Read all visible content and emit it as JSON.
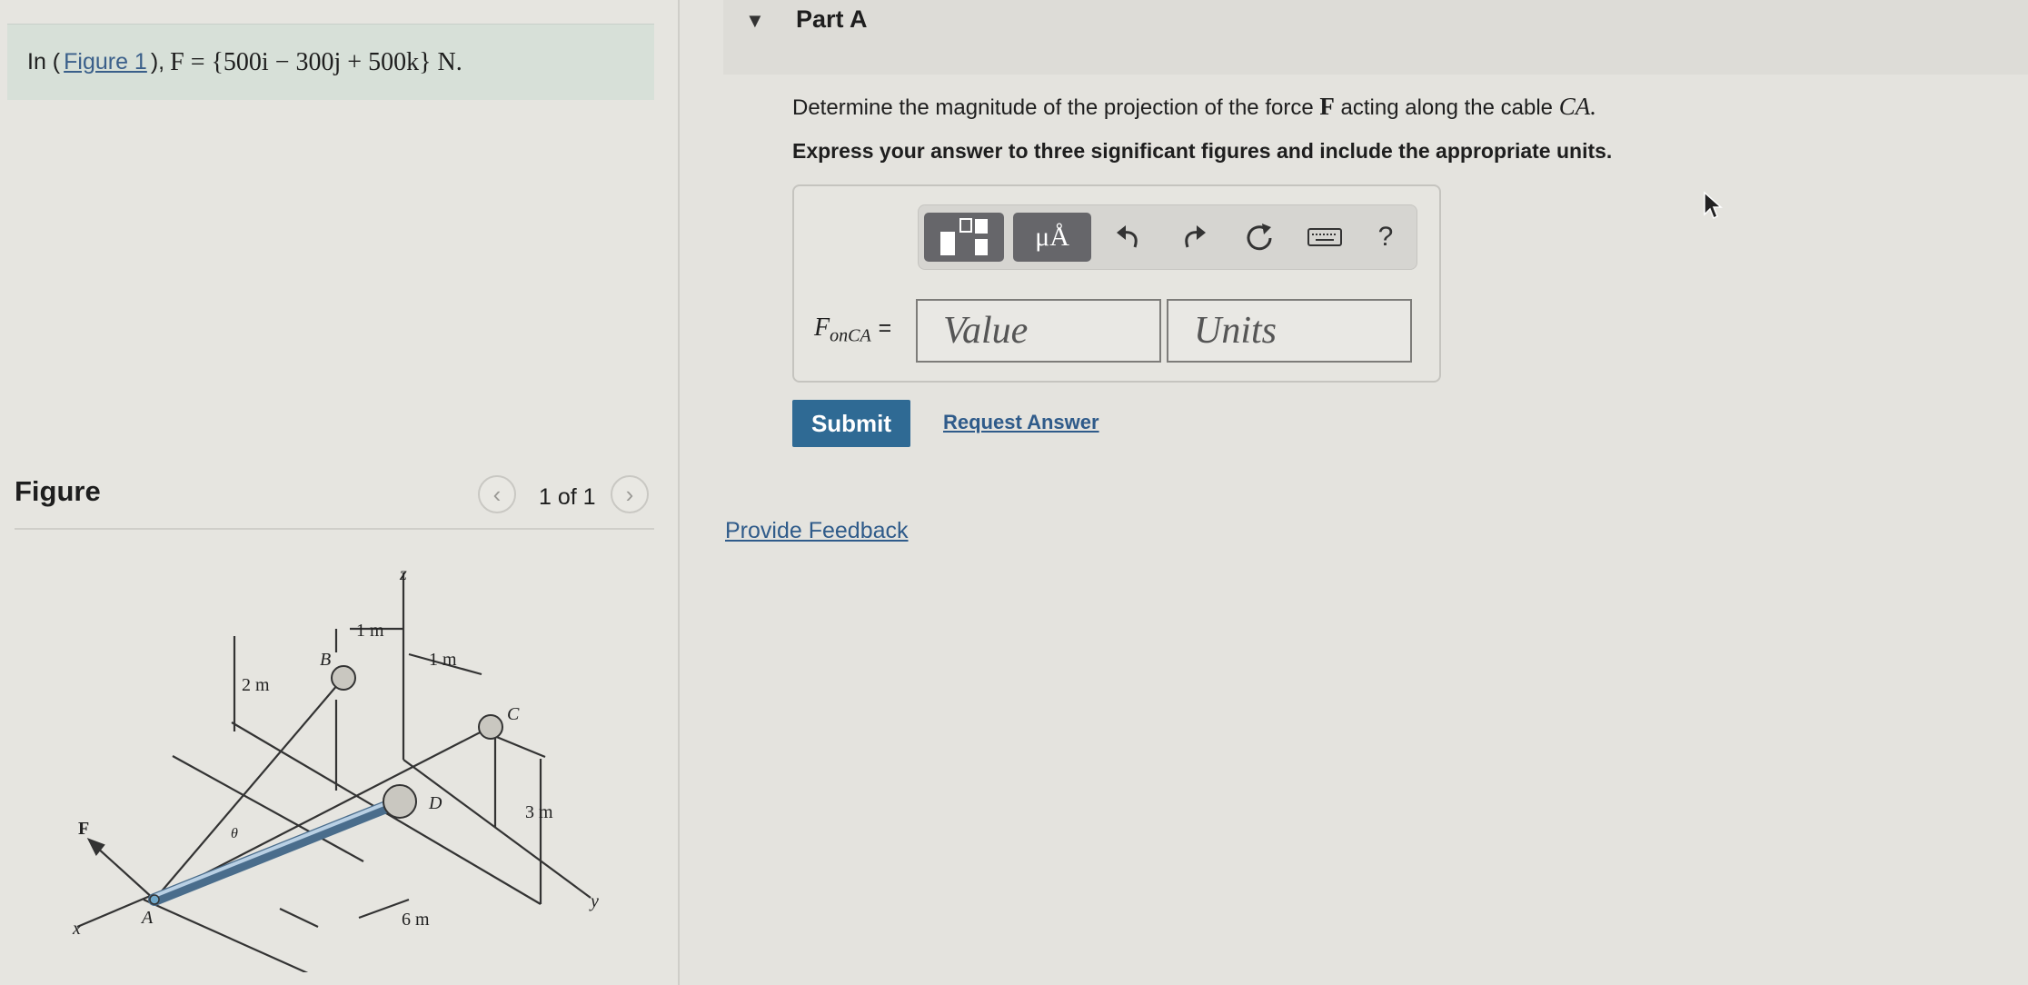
{
  "problem": {
    "prefix": "In (",
    "figure_link": "Figure 1",
    "suffix": "),",
    "equation": "F = {500i − 300j + 500k} N."
  },
  "figure_panel": {
    "title": "Figure",
    "page_indicator": "1 of 1",
    "diagram_labels": {
      "z": "z",
      "x": "x",
      "y": "y",
      "A": "A",
      "B": "B",
      "C": "C",
      "D": "D",
      "F": "F",
      "theta": "θ",
      "dim_1m_top": "1 m",
      "dim_1m_right": "1 m",
      "dim_2m": "2 m",
      "dim_3m": "3 m",
      "dim_6m": "6 m"
    }
  },
  "part": {
    "title": "Part A",
    "question_prefix": "Determine the magnitude of the projection of the force",
    "question_force": "F",
    "question_mid": "acting along the cable",
    "question_cable": "CA.",
    "instruction": "Express your answer to three significant figures and include the appropriate units."
  },
  "answer": {
    "label_var": "F",
    "label_sub": "onCA",
    "label_eq": "=",
    "value_placeholder": "Value",
    "units_placeholder": "Units",
    "units_button_label": "μÅ",
    "help_label": "?"
  },
  "actions": {
    "submit_label": "Submit",
    "request_label": "Request Answer",
    "feedback_label": "Provide Feedback"
  },
  "icons": {
    "collapse": "triangle-down-icon",
    "prev": "chevron-left-icon",
    "next": "chevron-right-icon",
    "templates": "templates-icon",
    "undo": "undo-icon",
    "redo": "redo-icon",
    "reset": "reset-icon",
    "keyboard": "keyboard-icon",
    "cursor": "mouse-pointer-icon"
  },
  "colors": {
    "accent": "#2f6a94",
    "link": "#2f5b8a",
    "problem_bg": "#d7e0d8"
  }
}
